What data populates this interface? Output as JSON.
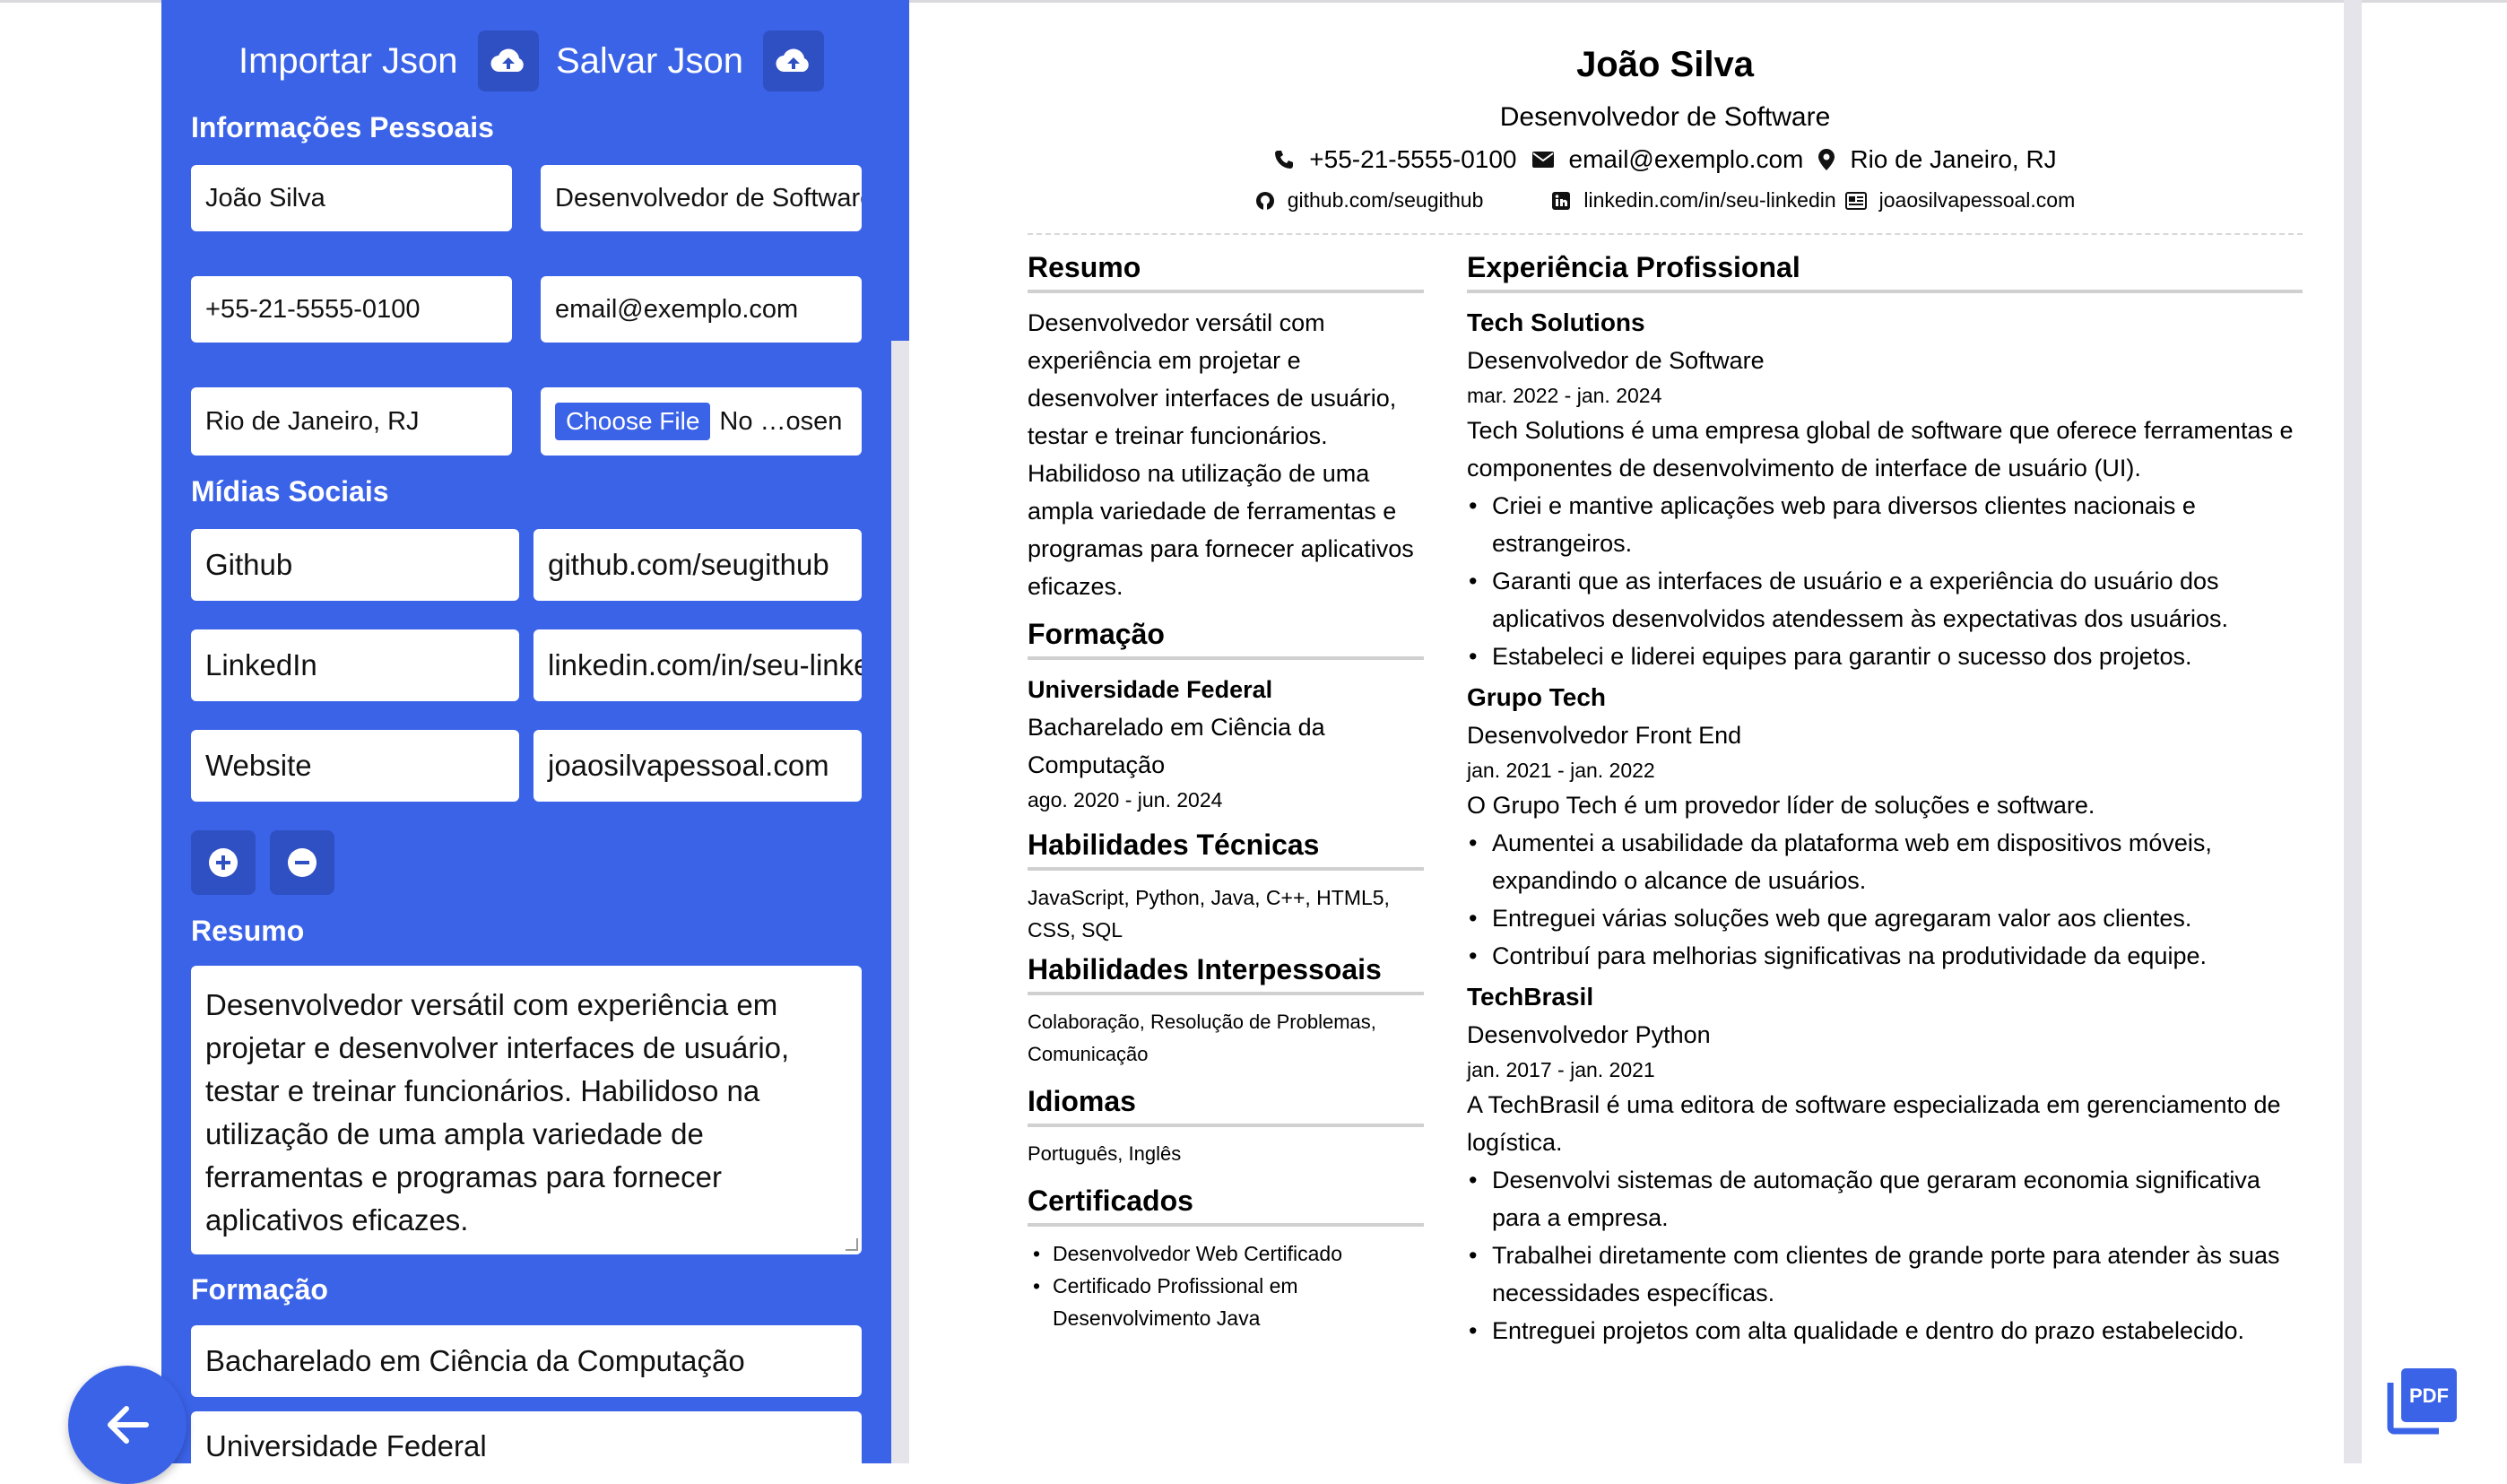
{
  "toolbar": {
    "import_label": "Importar Json",
    "save_label": "Salvar Json"
  },
  "form": {
    "personal_heading": "Informações Pessoais",
    "name": "João Silva",
    "title": "Desenvolvedor de Software",
    "phone": "+55-21-5555-0100",
    "email": "email@exemplo.com",
    "location": "Rio de Janeiro, RJ",
    "file_button": "Choose File",
    "file_status": "No …osen",
    "social_heading": "Mídias Sociais",
    "socials": [
      {
        "name": "Github",
        "url": "github.com/seugithub"
      },
      {
        "name": "LinkedIn",
        "url": "linkedin.com/in/seu-linkedin"
      },
      {
        "name": "Website",
        "url": "joaosilvapessoal.com"
      }
    ],
    "summary_heading": "Resumo",
    "summary": "Desenvolvedor versátil com experiência em projetar e desenvolver interfaces de usuário, testar e treinar funcionários. Habilidoso na utilização de uma ampla variedade de ferramentas e programas para fornecer aplicativos eficazes.",
    "education_heading": "Formação",
    "degree": "Bacharelado em Ciência da Computação",
    "school": "Universidade Federal"
  },
  "cv": {
    "name": "João Silva",
    "role": "Desenvolvedor de Software",
    "phone": "+55-21-5555-0100",
    "email": "email@exemplo.com",
    "location": "Rio de Janeiro, RJ",
    "github": "github.com/seugithub",
    "linkedin": "linkedin.com/in/seu-linkedin",
    "website": "joaosilvapessoal.com",
    "summary_title": "Resumo",
    "summary": "Desenvolvedor versátil com experiência em projetar e desenvolver interfaces de usuário, testar e treinar funcionários. Habilidoso na utilização de uma ampla variedade de ferramentas e programas para fornecer aplicativos eficazes.",
    "education_title": "Formação",
    "school": "Universidade Federal",
    "degree": "Bacharelado em Ciência da Computação",
    "edu_dates": "ago. 2020 - jun. 2024",
    "tech_title": "Habilidades Técnicas",
    "tech_skills": "JavaScript, Python, Java, C++, HTML5, CSS, SQL",
    "soft_title": "Habilidades Interpessoais",
    "soft_skills": "Colaboração, Resolução de Problemas, Comunicação",
    "lang_title": "Idiomas",
    "languages": "Português, Inglês",
    "cert_title": "Certificados",
    "certs": [
      "Desenvolvedor Web Certificado",
      "Certificado Profissional em Desenvolvimento Java"
    ],
    "exp_title": "Experiência Profissional",
    "jobs": [
      {
        "company": "Tech Solutions",
        "role": "Desenvolvedor de Software",
        "dates": "mar. 2022 - jan. 2024",
        "desc": "Tech Solutions é uma empresa global de software que oferece ferramen­tas e componentes de desenvolvimento de interface de usuário (UI).",
        "bullets": [
          "Criei e mantive aplicações web para diversos clientes nacionais e estrangeiros.",
          "Garanti que as interfaces de usuário e a experiência do usuário dos aplicativos desenvolvidos atendessem às expectativas dos usuários.",
          "Estabeleci e liderei equipes para garantir o sucesso dos projetos."
        ]
      },
      {
        "company": "Grupo Tech",
        "role": "Desenvolvedor Front End",
        "dates": "jan. 2021 - jan. 2022",
        "desc": "O Grupo Tech é um provedor líder de soluções e software.",
        "bullets": [
          "Aumentei a usabilidade da plataforma web em dispositivos móveis, expandindo o alcance de usuários.",
          "Entreguei várias soluções web que agregaram valor aos clientes.",
          "Contribuí para melhorias significativas na produtividade da equipe."
        ]
      },
      {
        "company": "TechBrasil",
        "role": "Desenvolvedor Python",
        "dates": "jan. 2017 - jan. 2021",
        "desc": "A TechBrasil é uma editora de software especializada em gerenciamento de logística.",
        "bullets": [
          "Desenvolvi sistemas de automação que geraram economia significativa para a empresa.",
          "Trabalhei diretamente com clientes de grande porte para atender às suas necessidades específicas.",
          "Entreguei projetos com alta qualidade e dentro do prazo estabelecido."
        ]
      }
    ]
  },
  "pdf_label": "PDF",
  "colors": {
    "accent": "#3b63e8",
    "accent_dark": "#2f50c2"
  }
}
